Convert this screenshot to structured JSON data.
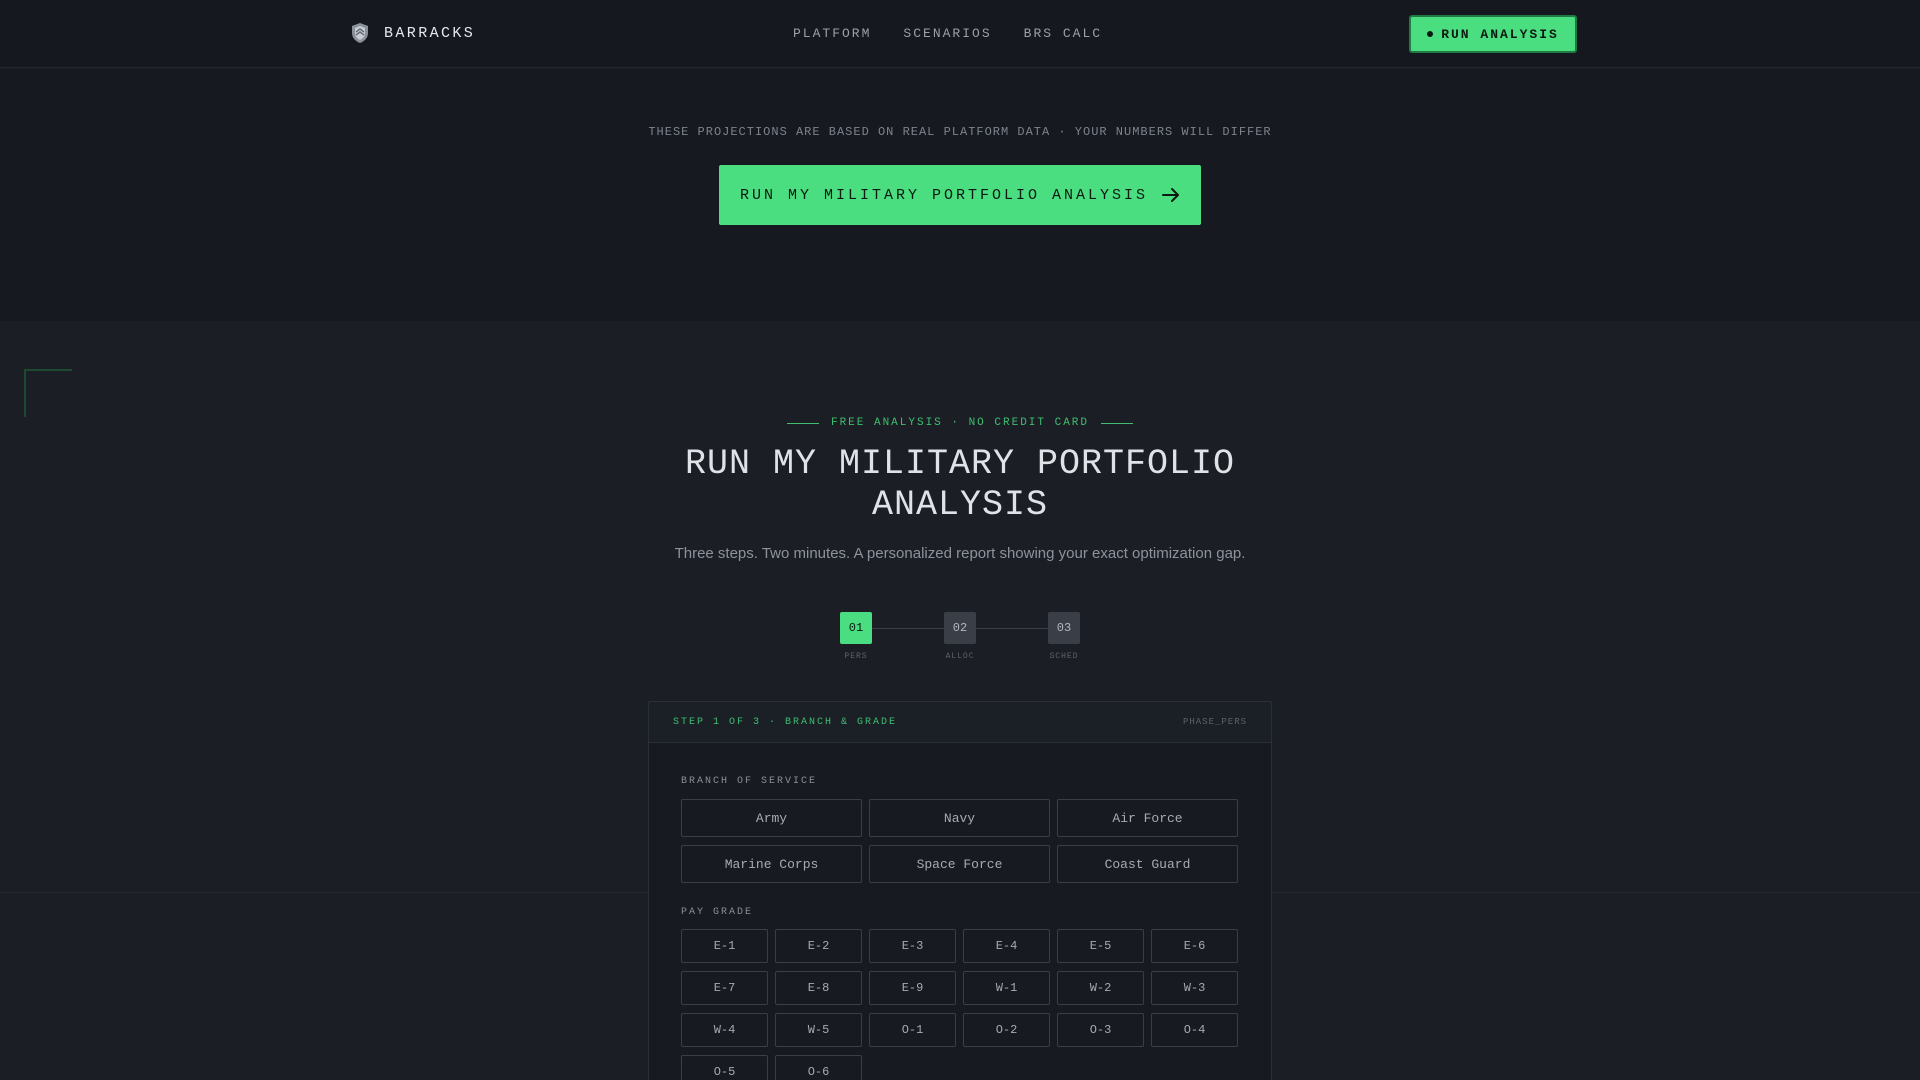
{
  "nav": {
    "brand": "BARRACKS",
    "links": [
      "PLATFORM",
      "SCENARIOS",
      "BRS CALC"
    ],
    "cta": "RUN ANALYSIS"
  },
  "hero": {
    "disclaimer": "THESE PROJECTIONS ARE BASED ON REAL PLATFORM DATA · YOUR NUMBERS WILL DIFFER",
    "cta": "RUN MY MILITARY PORTFOLIO ANALYSIS"
  },
  "main": {
    "eyebrow": "FREE ANALYSIS · NO CREDIT CARD",
    "title_line1": "RUN MY MILITARY PORTFOLIO",
    "title_line2": "ANALYSIS",
    "subtitle": "Three steps. Two minutes. A personalized report showing your exact optimization gap."
  },
  "steps": [
    {
      "num": "01",
      "label": "PERS",
      "active": true
    },
    {
      "num": "02",
      "label": "ALLOC",
      "active": false
    },
    {
      "num": "03",
      "label": "SCHED",
      "active": false
    }
  ],
  "card": {
    "step_text": "STEP 1 OF 3 · BRANCH & GRADE",
    "phase": "PHASE_PERS",
    "branch_label": "BRANCH OF SERVICE",
    "branches": [
      "Army",
      "Navy",
      "Air Force",
      "Marine Corps",
      "Space Force",
      "Coast Guard"
    ],
    "grade_label": "PAY GRADE",
    "grades": [
      "E-1",
      "E-2",
      "E-3",
      "E-4",
      "E-5",
      "E-6",
      "E-7",
      "E-8",
      "E-9",
      "W-1",
      "W-2",
      "W-3",
      "W-4",
      "W-5",
      "O-1",
      "O-2",
      "O-3",
      "O-4",
      "O-5",
      "O-6"
    ]
  },
  "colors": {
    "accent": "#4ade80",
    "background": "#1b1e25",
    "nav_background": "#15181e"
  },
  "icons": {
    "brand": "shield-logo-icon",
    "cta": "arrow-right-icon",
    "status": "dot-icon"
  }
}
